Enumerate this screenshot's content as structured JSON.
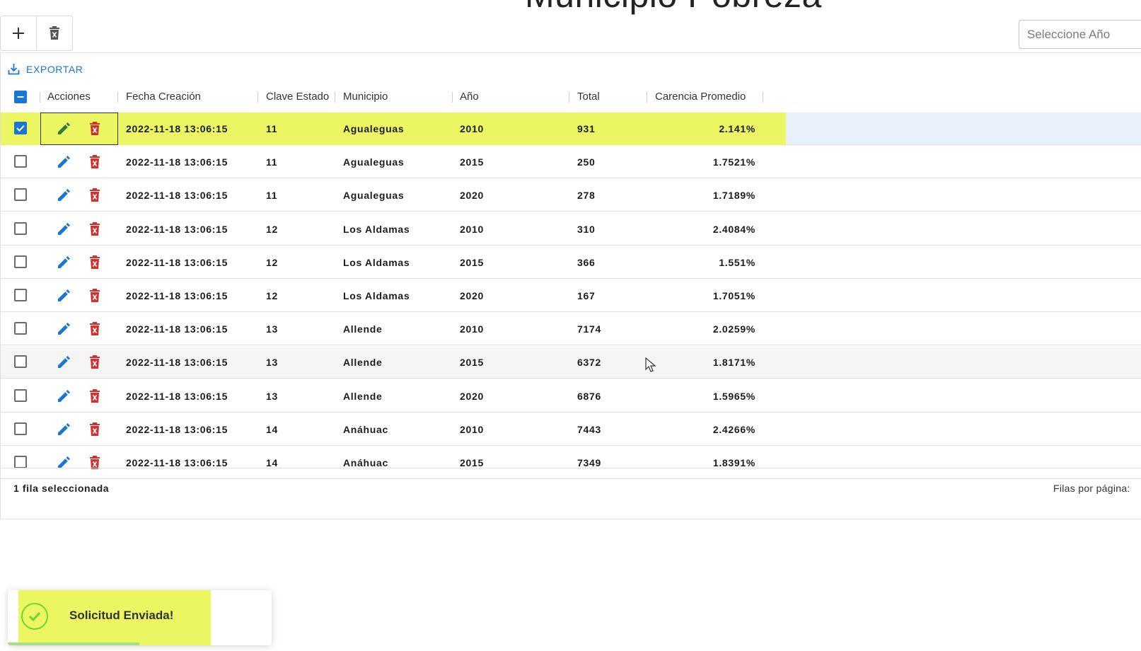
{
  "page": {
    "title": "Municipio Pobreza",
    "year_select_placeholder": "Seleccione Año"
  },
  "toolbar": {
    "add_icon": "plus-icon",
    "delete_icon": "delete-icon"
  },
  "grid": {
    "export_label": "EXPORTAR",
    "columns": [
      "Acciones",
      "Fecha Creación",
      "Clave Estado",
      "Municipio",
      "Año",
      "Total",
      "Carencia Promedio"
    ],
    "rows": [
      {
        "fecha": "2022-11-18 13:06:15",
        "clave": "11",
        "municipio": "Agualeguas",
        "anio": "2010",
        "total": "931",
        "carencia": "2.141%",
        "selected": true
      },
      {
        "fecha": "2022-11-18 13:06:15",
        "clave": "11",
        "municipio": "Agualeguas",
        "anio": "2015",
        "total": "250",
        "carencia": "1.7521%"
      },
      {
        "fecha": "2022-11-18 13:06:15",
        "clave": "11",
        "municipio": "Agualeguas",
        "anio": "2020",
        "total": "278",
        "carencia": "1.7189%"
      },
      {
        "fecha": "2022-11-18 13:06:15",
        "clave": "12",
        "municipio": "Los Aldamas",
        "anio": "2010",
        "total": "310",
        "carencia": "2.4084%"
      },
      {
        "fecha": "2022-11-18 13:06:15",
        "clave": "12",
        "municipio": "Los Aldamas",
        "anio": "2015",
        "total": "366",
        "carencia": "1.551%"
      },
      {
        "fecha": "2022-11-18 13:06:15",
        "clave": "12",
        "municipio": "Los Aldamas",
        "anio": "2020",
        "total": "167",
        "carencia": "1.7051%"
      },
      {
        "fecha": "2022-11-18 13:06:15",
        "clave": "13",
        "municipio": "Allende",
        "anio": "2010",
        "total": "7174",
        "carencia": "2.0259%"
      },
      {
        "fecha": "2022-11-18 13:06:15",
        "clave": "13",
        "municipio": "Allende",
        "anio": "2015",
        "total": "6372",
        "carencia": "1.8171%",
        "hover": true
      },
      {
        "fecha": "2022-11-18 13:06:15",
        "clave": "13",
        "municipio": "Allende",
        "anio": "2020",
        "total": "6876",
        "carencia": "1.5965%"
      },
      {
        "fecha": "2022-11-18 13:06:15",
        "clave": "14",
        "municipio": "Anáhuac",
        "anio": "2010",
        "total": "7443",
        "carencia": "2.4266%"
      },
      {
        "fecha": "2022-11-18 13:06:15",
        "clave": "14",
        "municipio": "Anáhuac",
        "anio": "2015",
        "total": "7349",
        "carencia": "1.8391%"
      }
    ],
    "footer": {
      "selected_text": "1 fila seleccionada",
      "rows_per_page_label": "Filas por página:"
    }
  },
  "toast": {
    "message": "Solicitud Enviada!",
    "icon": "check-circle-icon"
  },
  "colors": {
    "accent": "#1976d2",
    "edit_icon": "#1976d2",
    "edit_icon_selected": "#2e7d32",
    "delete_icon": "#d32f2f",
    "highlight": "#ecf562",
    "toast_success": "#07bc0c"
  }
}
